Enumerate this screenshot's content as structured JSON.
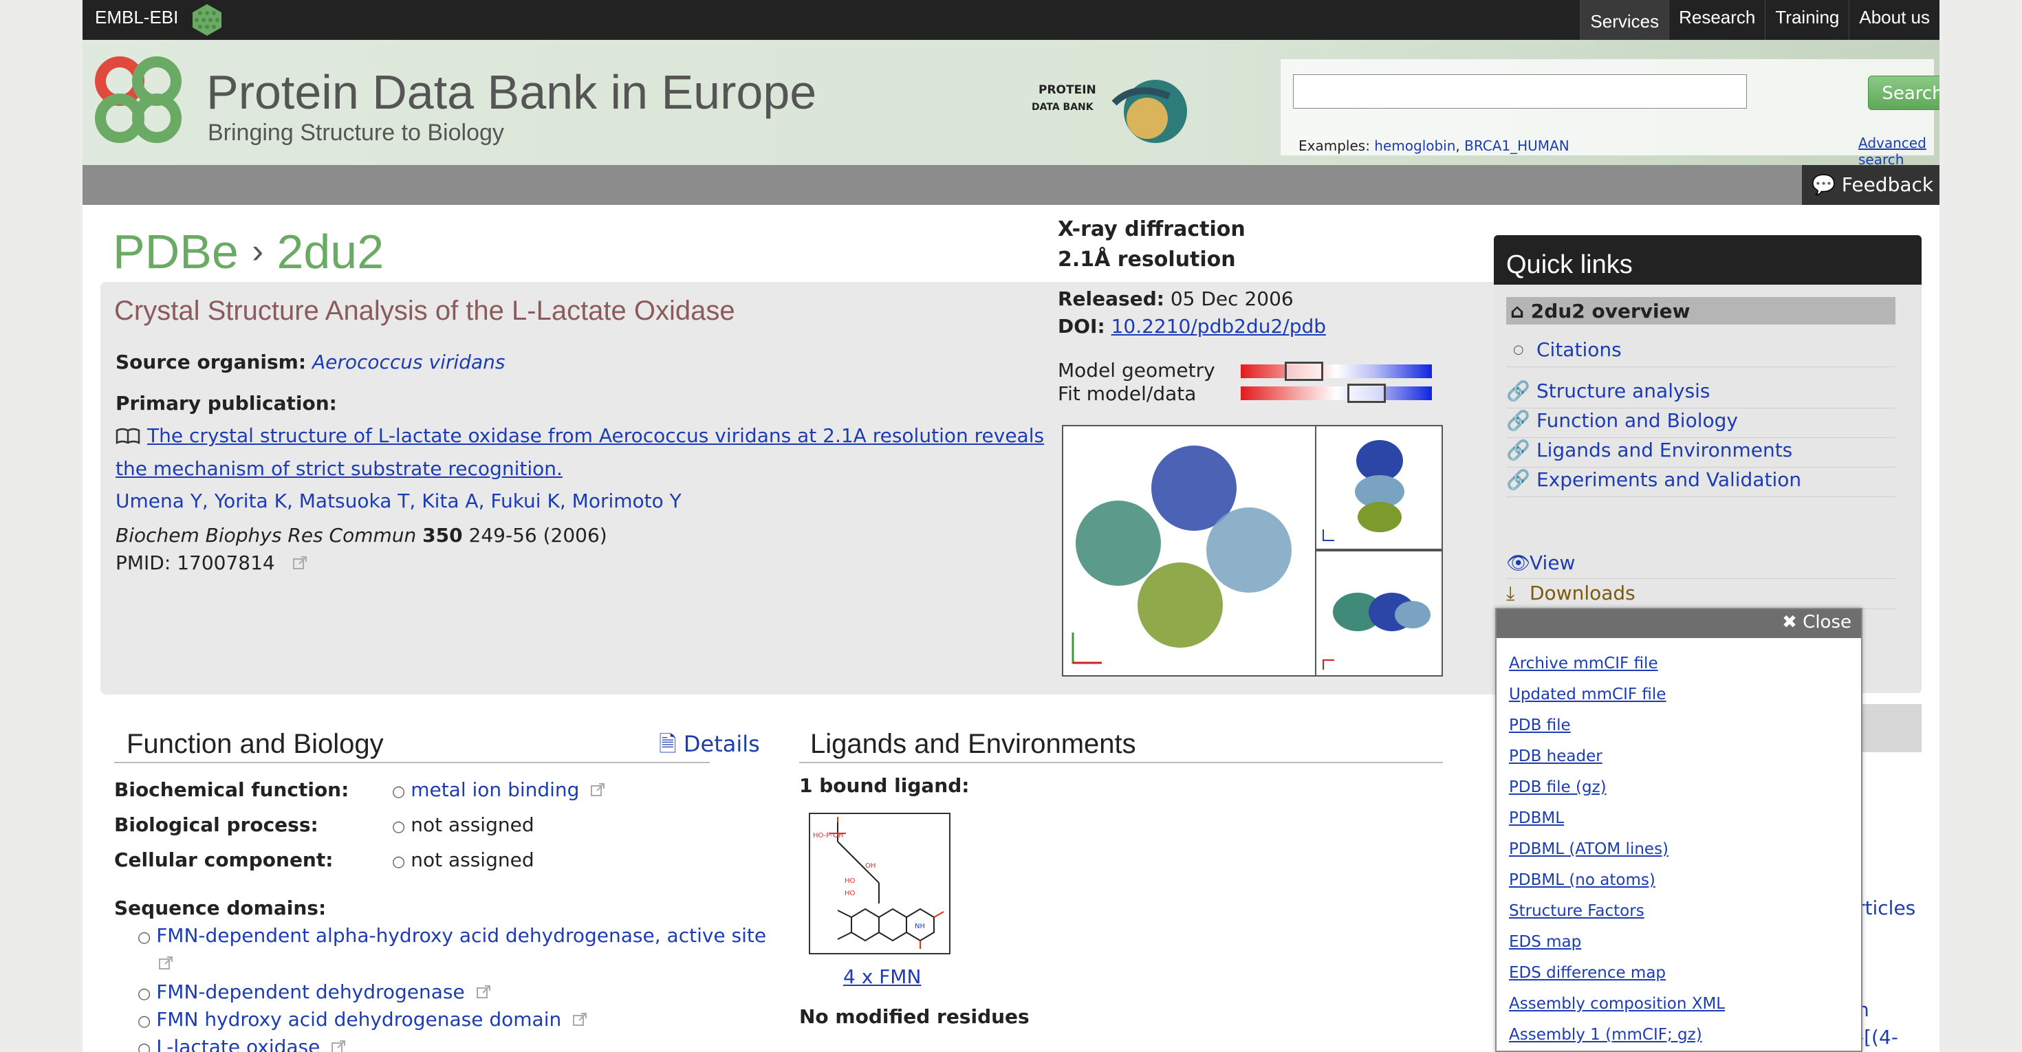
{
  "topbar": {
    "brand": "EMBL-EBI",
    "nav": [
      "Services",
      "Research",
      "Training",
      "About us"
    ]
  },
  "header": {
    "title": "Protein Data Bank in Europe",
    "subtitle": "Bringing Structure to Biology",
    "pdb50_line1": "PROTEIN",
    "pdb50_line2": "DATA BANK",
    "search_button": "Search",
    "examples_prefix": "Examples:",
    "example1": "hemoglobin",
    "example2": "BRCA1_HUMAN",
    "advanced_search": "Advanced search",
    "feedback": "Feedback"
  },
  "entry": {
    "breadcrumb_root": "PDBe",
    "breadcrumb_sep": "›",
    "id": "2du2",
    "method": "X-ray diffraction",
    "resolution": "2.1Å resolution",
    "title": "Crystal Structure Analysis of the L-Lactate Oxidase",
    "source_label": "Source organism:",
    "source_value": "Aerococcus viridans",
    "primary_pub_label": "Primary publication:",
    "pub_title": "The crystal structure of L-lactate oxidase from Aerococcus viridans at 2.1A resolution reveals the mechanism of strict substrate recognition.",
    "authors": [
      "Umena Y",
      "Yorita K",
      "Matsuoka T",
      "Kita A",
      "Fukui K",
      "Morimoto Y"
    ],
    "journal": "Biochem Biophys Res Commun",
    "volume": "350",
    "pages": "249-56 (2006)",
    "pmid": "PMID: 17007814",
    "released_label": "Released:",
    "released_value": "05 Dec 2006",
    "doi_label": "DOI:",
    "doi_value": "10.2210/pdb2du2/pdb",
    "model_geometry_label": "Model geometry",
    "fit_label": "Fit model/data",
    "model_geometry_percentile": 0.29,
    "fit_percentile": 0.7
  },
  "quick_links": {
    "title": "Quick links",
    "overview": "2du2 overview",
    "items": [
      "Citations",
      "Structure analysis",
      "Function and Biology",
      "Ligands and Environments",
      "Experiments and Validation"
    ],
    "view": "View",
    "downloads": "Downloads"
  },
  "downloads_popup": {
    "close": "Close",
    "items": [
      "Archive mmCIF file",
      "Updated mmCIF file",
      "PDB file",
      "PDB header",
      "PDB file (gz)",
      "PDBML",
      "PDBML (ATOM lines)",
      "PDBML (no atoms)",
      "Structure Factors",
      "EDS map",
      "EDS difference map",
      "Assembly composition XML",
      "Assembly 1 (mmCIF; gz)"
    ]
  },
  "side_partial": {
    "text1": "rticles",
    "text2": "n",
    "text3": "-[(4-"
  },
  "function_biology": {
    "title": "Function and Biology",
    "details": "Details",
    "biochemical_label": "Biochemical function:",
    "biochemical_value": "metal ion binding",
    "process_label": "Biological process:",
    "process_value": "not assigned",
    "component_label": "Cellular component:",
    "component_value": "not assigned",
    "seq_label": "Sequence domains:",
    "seq_domains": [
      "FMN-dependent alpha-hydroxy acid dehydrogenase, active site",
      "FMN-dependent dehydrogenase",
      "FMN hydroxy acid dehydrogenase domain",
      "L-lactate oxidase"
    ]
  },
  "ligands": {
    "title": "Ligands and Environments",
    "bound": "1 bound ligand:",
    "ligand_link": "4 x FMN",
    "no_modified": "No modified residues"
  },
  "colors": {
    "pdbe_green": "#6aaa64",
    "link_blue": "#1c3cb4",
    "title_brown": "#8b5a5a"
  }
}
